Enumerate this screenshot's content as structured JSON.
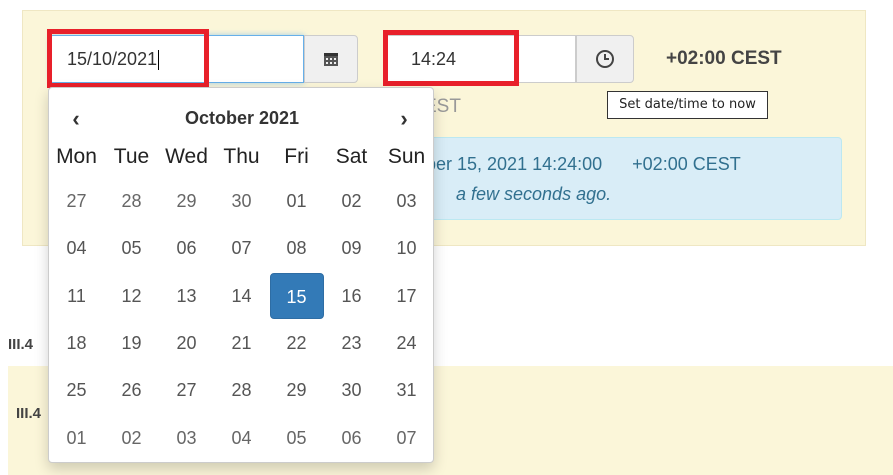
{
  "date_input": {
    "value": "15/10/2021"
  },
  "time_input": {
    "value": "14:24"
  },
  "timezone": {
    "label": "+02:00 CEST",
    "partial_below": "EST"
  },
  "tooltip": {
    "text": "Set date/time to now"
  },
  "info": {
    "line1_date": "ber 15, 2021 14:24:00",
    "line1_tz": "+02:00 CEST",
    "relative": "a few seconds ago."
  },
  "sections": {
    "label_1": "III.4",
    "label_2": "III.4"
  },
  "calendar": {
    "month_title": "October 2021",
    "prev_icon": "chevron-left",
    "next_icon": "chevron-right",
    "weekdays": [
      "Mon",
      "Tue",
      "Wed",
      "Thu",
      "Fri",
      "Sat",
      "Sun"
    ],
    "weeks": [
      [
        "27",
        "28",
        "29",
        "30",
        "01",
        "02",
        "03"
      ],
      [
        "04",
        "05",
        "06",
        "07",
        "08",
        "09",
        "10"
      ],
      [
        "11",
        "12",
        "13",
        "14",
        "15",
        "16",
        "17"
      ],
      [
        "18",
        "19",
        "20",
        "21",
        "22",
        "23",
        "24"
      ],
      [
        "25",
        "26",
        "27",
        "28",
        "29",
        "30",
        "31"
      ],
      [
        "01",
        "02",
        "03",
        "04",
        "05",
        "06",
        "07"
      ]
    ],
    "selected": "15",
    "accent_color": "#337ab7"
  },
  "highlight_color": "#e8202a"
}
